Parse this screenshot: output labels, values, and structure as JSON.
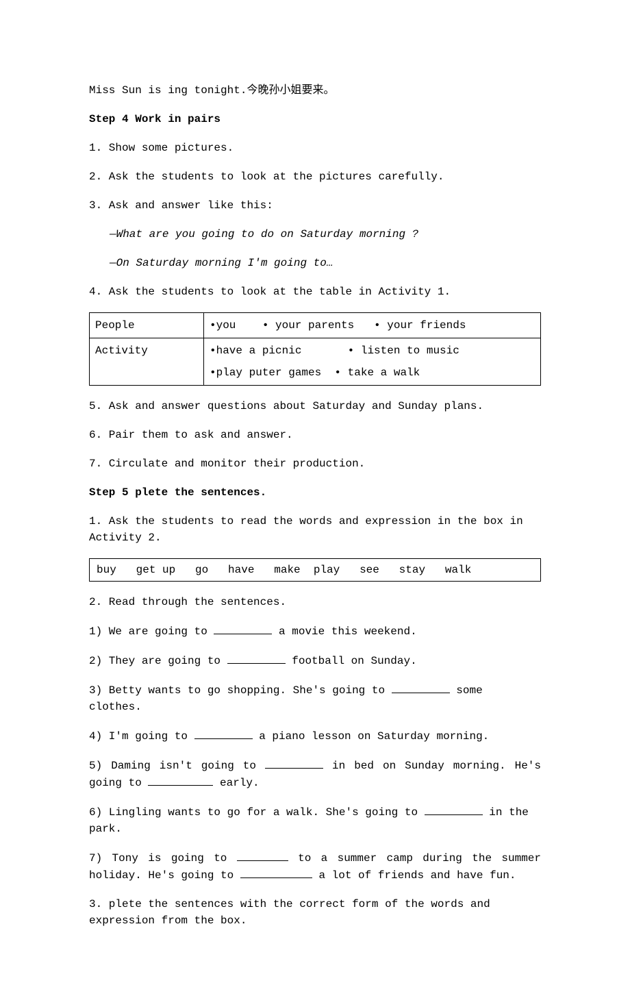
{
  "intro_line": "Miss Sun is ing tonight.今晚孙小姐要来。",
  "step4": {
    "heading": "Step 4 Work in pairs",
    "items": {
      "i1": "1. Show some pictures.",
      "i2": "2. Ask the students to look at the pictures carefully.",
      "i3": "3. Ask and answer like this:",
      "i3a": "—What are you going to do on Saturday morning ?",
      "i3b": "—On Saturday morning I'm going to…",
      "i4": "4. Ask the students to look at the table in Activity 1.",
      "table": {
        "r1c1": "People",
        "r1c2": "•you    • your parents   • your friends",
        "r2c1": "Activity",
        "r2c2a": "•have a picnic       • listen to music",
        "r2c2b": "•play puter games  • take a walk"
      },
      "i5": "5. Ask and answer questions about Saturday and Sunday plans.",
      "i6": "6. Pair them to ask and answer.",
      "i7": "7. Circulate and monitor their production."
    }
  },
  "step5": {
    "heading": "Step 5 plete the sentences.",
    "i1": "1. Ask the students to read the words and expression in the box in Activity 2.",
    "wordbox": "buy   get up   go   have   make  play   see   stay   walk",
    "i2": "2. Read through the sentences.",
    "q1a": "1) We are going to ",
    "q1b": " a movie this weekend.",
    "q2a": "2) They are going to ",
    "q2b": " football on Sunday.",
    "q3a": "3) Betty wants to go shopping. She's going to ",
    "q3b": " some clothes.",
    "q4a": "4) I'm going to ",
    "q4b": " a piano lesson on Saturday morning.",
    "q5a": "5) Daming isn't going to ",
    "q5b": " in bed on Sunday morning. He's going to ",
    "q5c": " early.",
    "q6a": "6) Lingling wants to go for a walk. She's going to ",
    "q6b": " in the park.",
    "q7a": "7) Tony is going to ",
    "q7b": " to a summer camp during the summer holiday. He's going to ",
    "q7c": " a lot of friends and have fun.",
    "i3": "3. plete the sentences with the correct form of the words and expression from the box."
  }
}
